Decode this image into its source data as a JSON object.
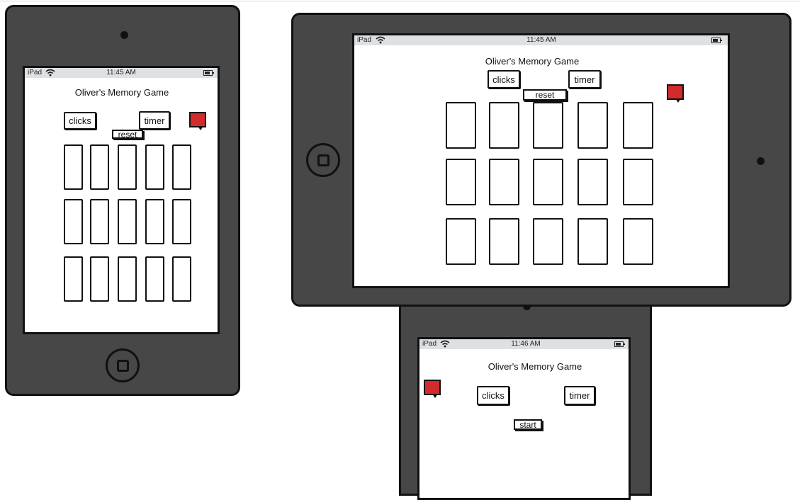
{
  "status": {
    "carrier": "iPad",
    "time_portrait": "11:45 AM",
    "time_landscape": "11:45 AM",
    "time_small": "11:46 AM"
  },
  "game": {
    "title": "Oliver's Memory Game",
    "clicks_label": "clicks",
    "timer_label": "timer",
    "reset_label": "reset",
    "start_label": "start"
  },
  "colors": {
    "device_body": "#474747",
    "flag": "#d22b2b",
    "status_bar": "#dde1e4"
  },
  "icons": [
    "wifi-icon",
    "battery-icon",
    "home-button-icon",
    "camera-icon",
    "flag-icon"
  ],
  "grid": {
    "rows": 3,
    "columns": 5
  }
}
